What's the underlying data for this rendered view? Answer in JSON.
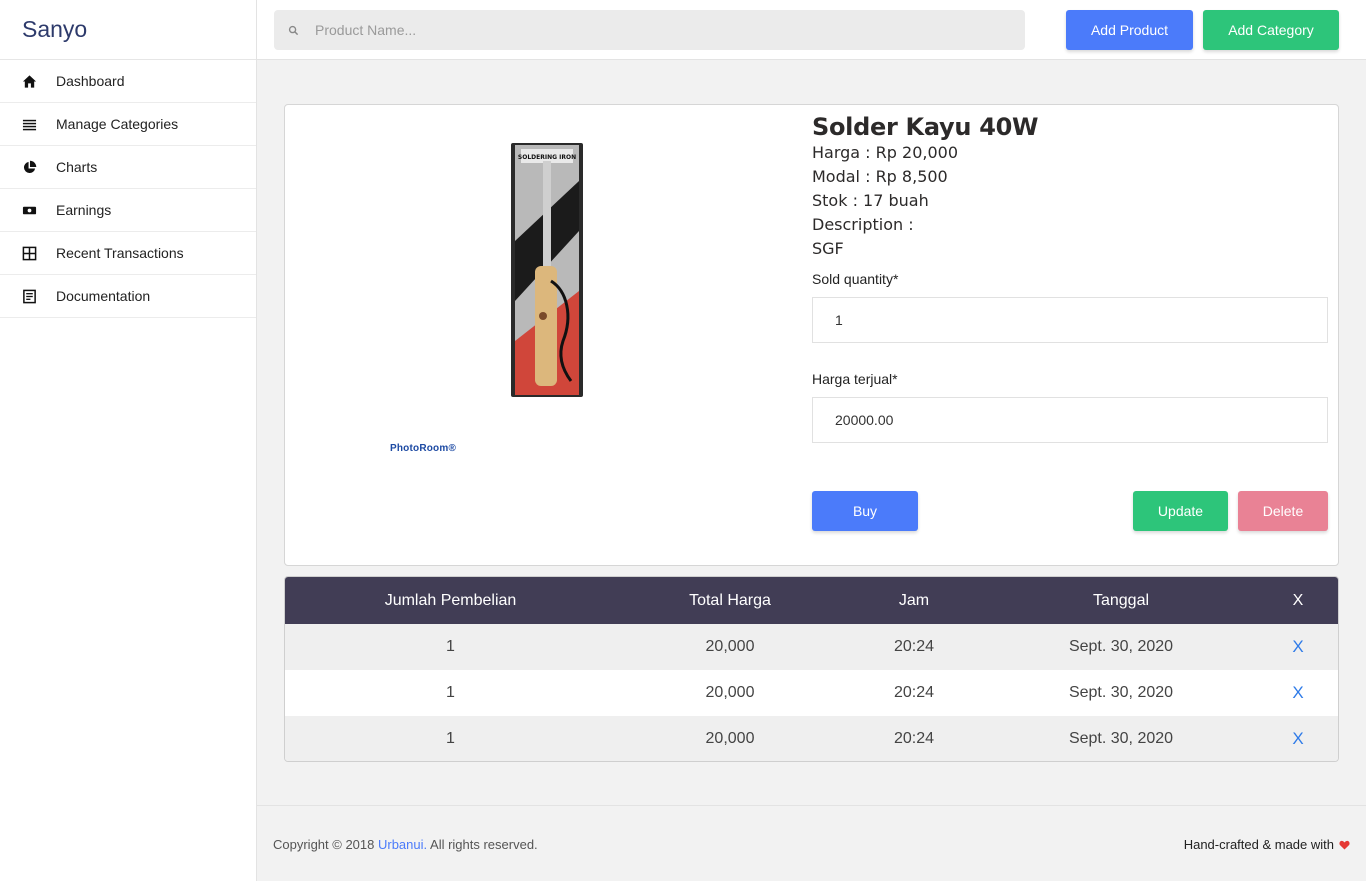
{
  "brand": "Sanyo",
  "sidebar": {
    "items": [
      {
        "label": "Dashboard",
        "icon": "home-icon"
      },
      {
        "label": "Manage Categories",
        "icon": "menu-lines-icon"
      },
      {
        "label": "Charts",
        "icon": "pie-chart-icon"
      },
      {
        "label": "Earnings",
        "icon": "money-icon"
      },
      {
        "label": "Recent Transactions",
        "icon": "grid-icon"
      },
      {
        "label": "Documentation",
        "icon": "document-icon"
      }
    ]
  },
  "topbar": {
    "search_placeholder": "Product Name...",
    "add_product": "Add Product",
    "add_category": "Add Category"
  },
  "product": {
    "title": "Solder Kayu 40W",
    "harga": "Harga : Rp 20,000",
    "modal": "Modal : Rp 8,500",
    "stok": "Stok : 17 buah",
    "description_label": "Description :",
    "description": "SGF",
    "image_package_text": "SOLDERING IRON",
    "watermark": "PhotoRoom®"
  },
  "form": {
    "sold_quantity_label": "Sold quantity*",
    "sold_quantity_value": "1",
    "harga_terjual_label": "Harga terjual*",
    "harga_terjual_value": "20000.00",
    "buy": "Buy",
    "update": "Update",
    "delete": "Delete"
  },
  "table": {
    "headers": [
      "Jumlah Pembelian",
      "Total Harga",
      "Jam",
      "Tanggal",
      "X"
    ],
    "rows": [
      [
        "1",
        "20,000",
        "20:24",
        "Sept. 30, 2020",
        "X"
      ],
      [
        "1",
        "20,000",
        "20:24",
        "Sept. 30, 2020",
        "X"
      ],
      [
        "1",
        "20,000",
        "20:24",
        "Sept. 30, 2020",
        "X"
      ]
    ]
  },
  "footer": {
    "copyright_prefix": "Copyright © 2018 ",
    "copyright_link": "Urbanui.",
    "copyright_suffix": " All rights reserved.",
    "made_with": "Hand-crafted & made with"
  },
  "colors": {
    "primary": "#4b7bfa",
    "success": "#2dc57a",
    "danger": "#e98295",
    "table_header": "#413d55",
    "brand_text": "#2d3a6b",
    "heart": "#e53935"
  }
}
